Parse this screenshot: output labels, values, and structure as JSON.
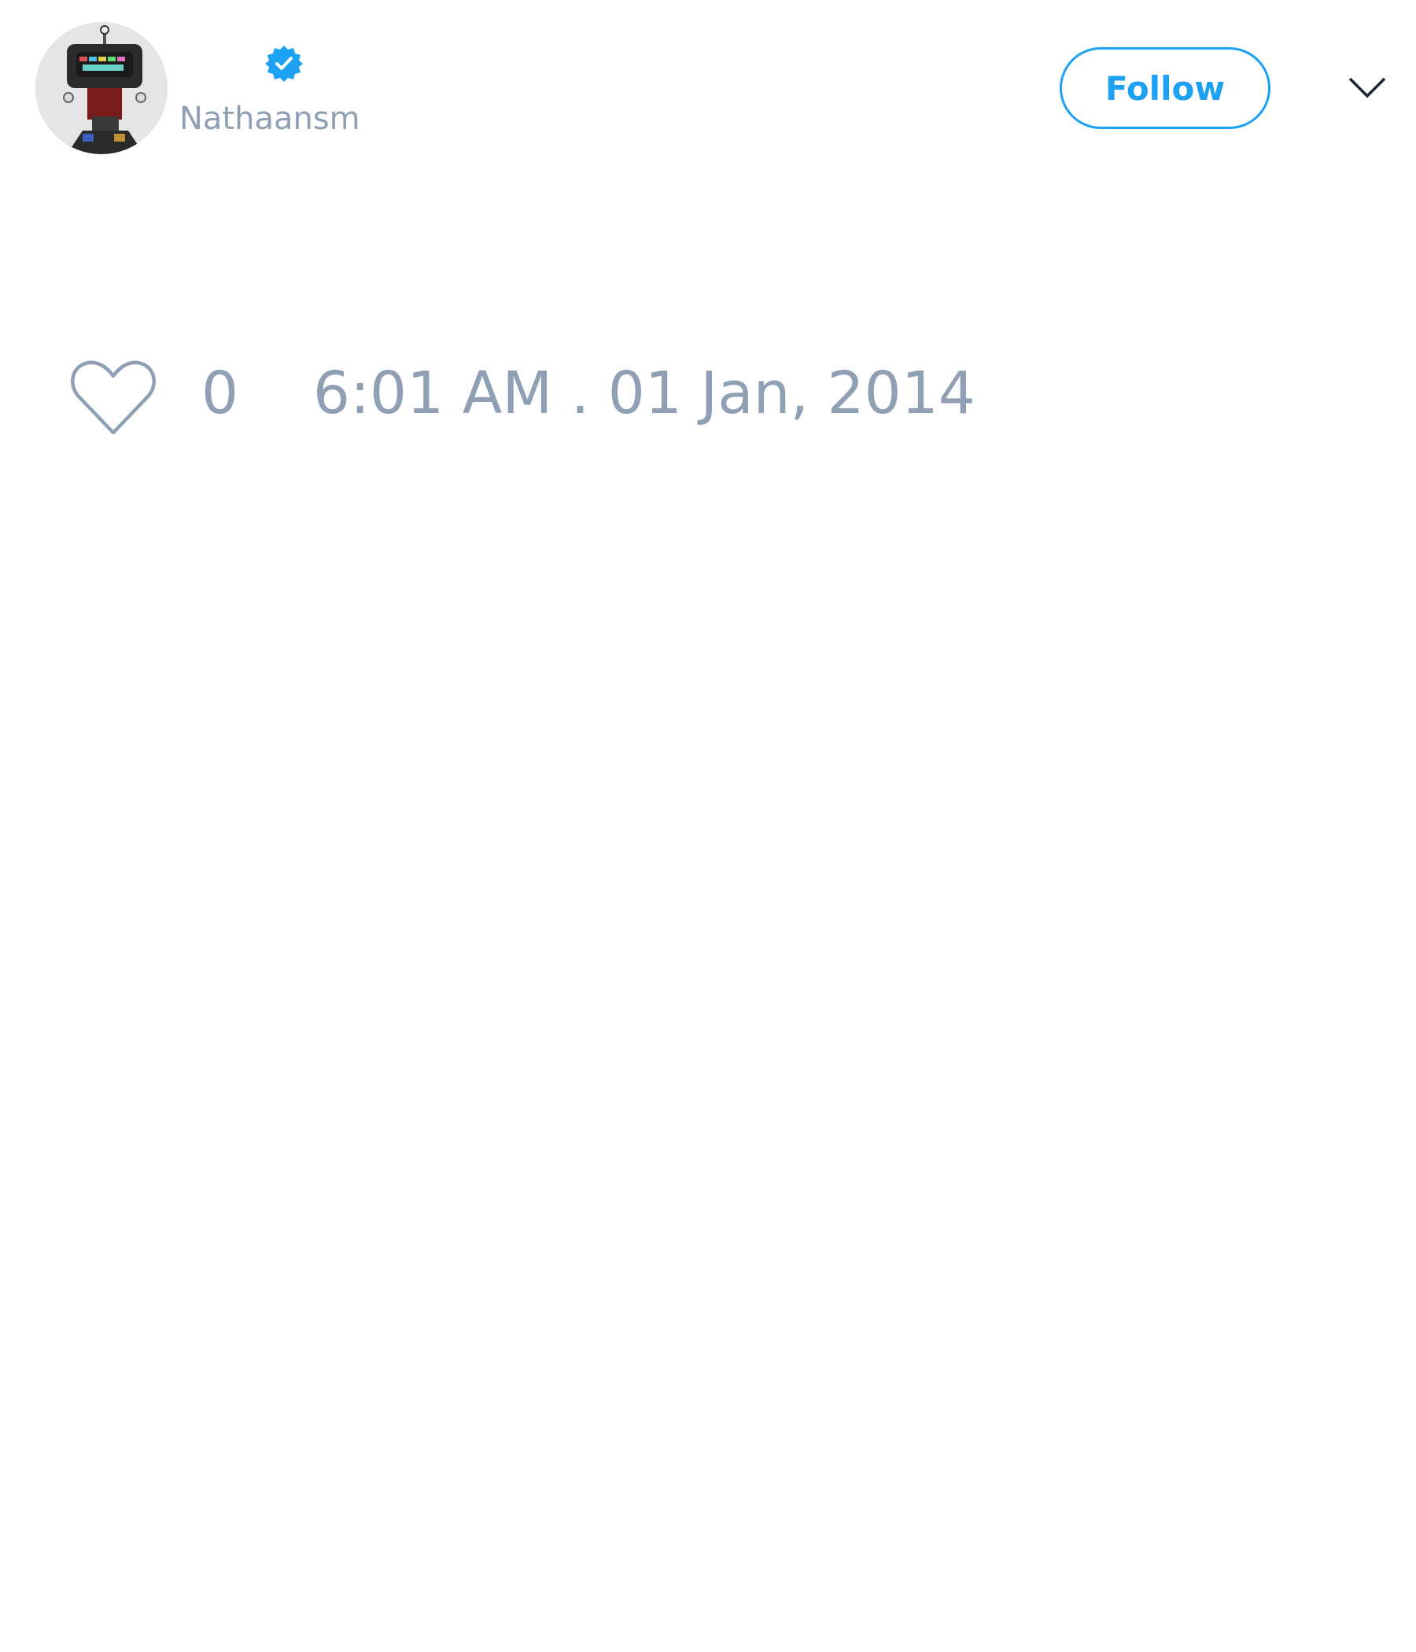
{
  "tweet": {
    "author": {
      "display_name": "",
      "handle": "Nathaansm",
      "verified": true,
      "avatar_icon": "robot-avatar"
    },
    "follow_label": "Follow",
    "menu_icon": "chevron-down-icon",
    "like_icon": "heart-outline-icon",
    "like_count": "0",
    "timestamp": "6:01 AM . 01 Jan, 2014"
  },
  "colors": {
    "accent": "#1da1f2",
    "muted_text": "#8f9fb4",
    "background": "#ffffff"
  }
}
